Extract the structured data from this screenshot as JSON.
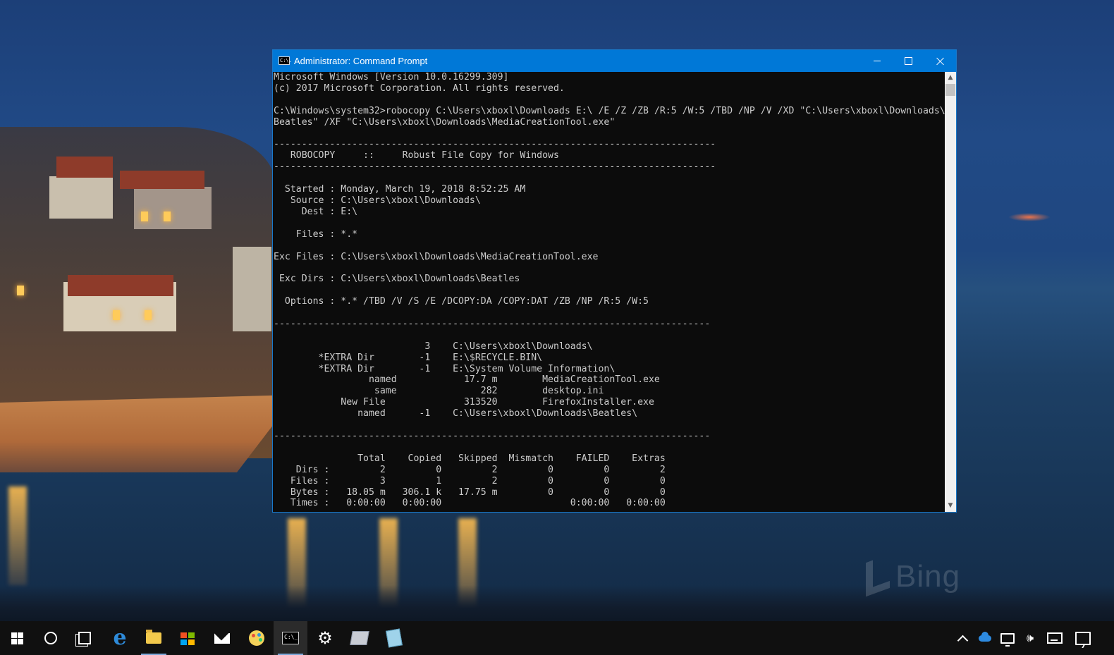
{
  "window": {
    "title": "Administrator: Command Prompt",
    "app_icon_label": "C:\\.",
    "controls": [
      "minimize",
      "maximize",
      "close"
    ]
  },
  "console": {
    "text_color": "#cccccc",
    "background": "#0c0c0c",
    "output": "Microsoft Windows [Version 10.0.16299.309]\n(c) 2017 Microsoft Corporation. All rights reserved.\n\nC:\\Windows\\system32>robocopy C:\\Users\\xboxl\\Downloads E:\\ /E /Z /ZB /R:5 /W:5 /TBD /NP /V /XD \"C:\\Users\\xboxl\\Downloads\\\nBeatles\" /XF \"C:\\Users\\xboxl\\Downloads\\MediaCreationTool.exe\"\n\n-------------------------------------------------------------------------------\n   ROBOCOPY     ::     Robust File Copy for Windows\n-------------------------------------------------------------------------------\n\n  Started : Monday, March 19, 2018 8:52:25 AM\n   Source : C:\\Users\\xboxl\\Downloads\\\n     Dest : E:\\\n\n    Files : *.*\n\nExc Files : C:\\Users\\xboxl\\Downloads\\MediaCreationTool.exe\n\n Exc Dirs : C:\\Users\\xboxl\\Downloads\\Beatles\n\n  Options : *.* /TBD /V /S /E /DCOPY:DA /COPY:DAT /ZB /NP /R:5 /W:5\n\n------------------------------------------------------------------------------\n\n                           3    C:\\Users\\xboxl\\Downloads\\\n        *EXTRA Dir        -1    E:\\$RECYCLE.BIN\\\n        *EXTRA Dir        -1    E:\\System Volume Information\\\n                 named            17.7 m        MediaCreationTool.exe\n                  same               282        desktop.ini\n            New File              313520        FirefoxInstaller.exe\n               named      -1    C:\\Users\\xboxl\\Downloads\\Beatles\\\n\n------------------------------------------------------------------------------\n\n               Total    Copied   Skipped  Mismatch    FAILED    Extras\n    Dirs :         2         0         2         0         0         2\n   Files :         3         1         2         0         0         0\n   Bytes :   18.05 m   306.1 k   17.75 m         0         0         0\n   Times :   0:00:00   0:00:00                       0:00:00   0:00:00"
  },
  "scrollbar": {
    "up_arrow": "▲",
    "down_arrow": "▼"
  },
  "desktop": {
    "watermark": "Bing"
  },
  "taskbar": {
    "items": [
      {
        "name": "start",
        "icon": "windows-logo-icon"
      },
      {
        "name": "cortana",
        "icon": "cortana-circle-icon"
      },
      {
        "name": "task-view",
        "icon": "task-view-icon"
      },
      {
        "name": "edge",
        "icon": "edge-icon",
        "glyph": "e"
      },
      {
        "name": "file-explorer",
        "icon": "folder-icon"
      },
      {
        "name": "store",
        "icon": "store-icon"
      },
      {
        "name": "mail",
        "icon": "mail-icon"
      },
      {
        "name": "paint-3d",
        "icon": "paint-icon"
      },
      {
        "name": "command-prompt",
        "icon": "command-prompt-icon",
        "glyph": "C:\\_",
        "active": true
      },
      {
        "name": "settings",
        "icon": "gear-icon",
        "glyph": "⚙"
      },
      {
        "name": "app-box",
        "icon": "box-icon"
      },
      {
        "name": "notepad",
        "icon": "notepad-icon"
      }
    ],
    "tray": [
      {
        "name": "show-hidden-icons",
        "icon": "chevron-up-icon"
      },
      {
        "name": "onedrive",
        "icon": "cloud-icon"
      },
      {
        "name": "network",
        "icon": "network-icon"
      },
      {
        "name": "volume",
        "icon": "volume-icon",
        "glyph": "🕪"
      },
      {
        "name": "touch-keyboard",
        "icon": "keyboard-icon"
      },
      {
        "name": "action-center",
        "icon": "notification-icon"
      }
    ],
    "accent": "#7aa7d8"
  }
}
